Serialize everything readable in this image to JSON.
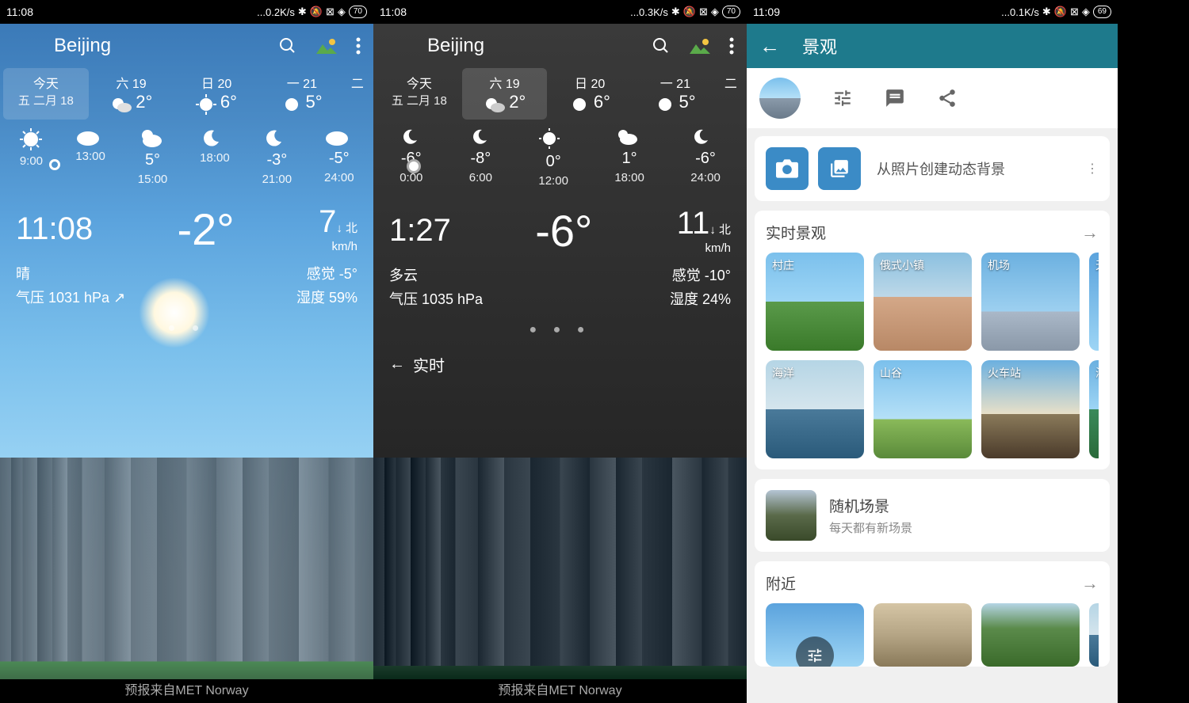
{
  "status": {
    "p1": {
      "time": "11:08",
      "net": "...0.2K/s",
      "battery": "70"
    },
    "p2": {
      "time": "11:08",
      "net": "...0.3K/s",
      "battery": "70"
    },
    "p3": {
      "time": "11:09",
      "net": "...0.1K/s",
      "battery": "69"
    }
  },
  "p1": {
    "city": "Beijing",
    "days": [
      {
        "label": "今天",
        "sub": "五 二月 18"
      },
      {
        "label": "六 19",
        "temp": "2°"
      },
      {
        "label": "日 20",
        "temp": "6°"
      },
      {
        "label": "一 21",
        "temp": "5°"
      },
      {
        "label": "二"
      }
    ],
    "hours": [
      {
        "time": "9:00",
        "temp": ""
      },
      {
        "time": "13:00",
        "temp": ""
      },
      {
        "time": "15:00",
        "temp": "5°"
      },
      {
        "time": "18:00",
        "temp": ""
      },
      {
        "time": "21:00",
        "temp": "-3°"
      },
      {
        "time": "24:00",
        "temp": "-5°"
      }
    ],
    "now": {
      "time": "11:08",
      "temp": "-2°",
      "wind_speed": "7",
      "wind_unit": "km/h",
      "wind_dir": "北"
    },
    "details": {
      "condition": "晴",
      "feels": "感觉 -5°",
      "pressure": "气压 1031 hPa",
      "humidity": "湿度 59%"
    },
    "footer": "预报来自MET Norway"
  },
  "p2": {
    "city": "Beijing",
    "days": [
      {
        "label": "今天",
        "sub": "五 二月 18"
      },
      {
        "label": "六 19",
        "temp": "2°"
      },
      {
        "label": "日 20",
        "temp": "6°"
      },
      {
        "label": "一 21",
        "temp": "5°"
      },
      {
        "label": "二"
      }
    ],
    "hours": [
      {
        "time": "0:00",
        "temp": "-6°"
      },
      {
        "time": "6:00",
        "temp": "-8°"
      },
      {
        "time": "12:00",
        "temp": "0°"
      },
      {
        "time": "18:00",
        "temp": "1°"
      },
      {
        "time": "24:00",
        "temp": "-6°"
      }
    ],
    "now": {
      "time": "1:27",
      "temp": "-6°",
      "wind_speed": "11",
      "wind_unit": "km/h",
      "wind_dir": "北"
    },
    "details": {
      "condition": "多云",
      "feels": "感觉 -10°",
      "pressure": "气压 1035 hPa",
      "humidity": "湿度 24%"
    },
    "realtime": "实时",
    "footer": "预报来自MET Norway"
  },
  "p3": {
    "title": "景观",
    "create_from_photo": "从照片创建动态背景",
    "section_live": "实时景观",
    "thumbs1": [
      {
        "label": "村庄"
      },
      {
        "label": "俄式小镇"
      },
      {
        "label": "机场"
      },
      {
        "label": "天空"
      }
    ],
    "thumbs2": [
      {
        "label": "海洋"
      },
      {
        "label": "山谷"
      },
      {
        "label": "火车站"
      },
      {
        "label": "海边"
      }
    ],
    "random": {
      "title": "随机场景",
      "sub": "每天都有新场景"
    },
    "section_nearby": "附近"
  }
}
